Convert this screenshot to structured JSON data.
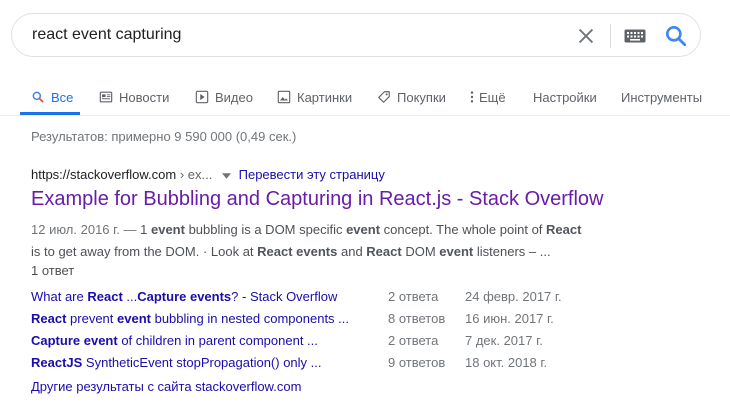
{
  "search": {
    "query": "react event capturing",
    "clear_icon": "close-icon",
    "keyboard_icon": "keyboard-icon",
    "search_icon": "search-icon"
  },
  "tabs": [
    {
      "label": "Все",
      "icon": "search-icon",
      "active": true
    },
    {
      "label": "Новости",
      "icon": "newspaper-icon"
    },
    {
      "label": "Видео",
      "icon": "play-icon"
    },
    {
      "label": "Картинки",
      "icon": "image-icon"
    },
    {
      "label": "Покупки",
      "icon": "tag-icon"
    },
    {
      "label": "Ещё",
      "icon": "more-vert-icon"
    },
    {
      "label": "Настройки"
    },
    {
      "label": "Инструменты"
    }
  ],
  "stats": "Результатов: примерно 9 590 000 (0,49 сек.)",
  "result": {
    "site": "https://stackoverflow.com",
    "path": "› ex...",
    "translate": "Перевести эту страницу",
    "title": "Example for Bubbling and Capturing in React.js - Stack Overflow",
    "date": "12 июл. 2016 г. — ",
    "snippet_line1": [
      {
        "t": "1 ",
        "b": false
      },
      {
        "t": "event",
        "b": true
      },
      {
        "t": " bubbling is a DOM specific ",
        "b": false
      },
      {
        "t": "event",
        "b": true
      },
      {
        "t": " concept. The whole point of ",
        "b": false
      },
      {
        "t": "React",
        "b": true
      }
    ],
    "snippet_line2": [
      {
        "t": "is to get away from the DOM. · Look at ",
        "b": false
      },
      {
        "t": "React events",
        "b": true
      },
      {
        "t": " and ",
        "b": false
      },
      {
        "t": "React",
        "b": true
      },
      {
        "t": " DOM ",
        "b": false
      },
      {
        "t": "event",
        "b": true
      },
      {
        "t": " listeners –  ...",
        "b": false
      }
    ],
    "answers": "1 ответ"
  },
  "subresults": [
    {
      "parts": [
        {
          "t": "What are ",
          "b": false
        },
        {
          "t": "React",
          "b": true
        },
        {
          "t": " ...",
          "b": false
        },
        {
          "t": "Capture events",
          "b": true
        },
        {
          "t": "? - Stack Overflow",
          "b": false
        }
      ],
      "answers": "2 ответа",
      "date": "24 февр. 2017 г."
    },
    {
      "parts": [
        {
          "t": "React",
          "b": true
        },
        {
          "t": " prevent ",
          "b": false
        },
        {
          "t": "event",
          "b": true
        },
        {
          "t": " bubbling in nested components ...",
          "b": false
        }
      ],
      "answers": "8 ответов",
      "date": "16 июн. 2017 г."
    },
    {
      "parts": [
        {
          "t": "Capture event",
          "b": true
        },
        {
          "t": " of children in parent component ...",
          "b": false
        }
      ],
      "answers": "2 ответа",
      "date": "7 дек. 2017 г."
    },
    {
      "parts": [
        {
          "t": "ReactJS",
          "b": true
        },
        {
          "t": " SyntheticEvent stopPropagation() only ...",
          "b": false
        }
      ],
      "answers": "9 ответов",
      "date": "18 окт. 2018 г."
    }
  ],
  "more_results": "Другие результаты с сайта stackoverflow.com",
  "colors": {
    "accent": "#1a73e8",
    "link": "#1a0dab",
    "visited": "#681da8"
  }
}
